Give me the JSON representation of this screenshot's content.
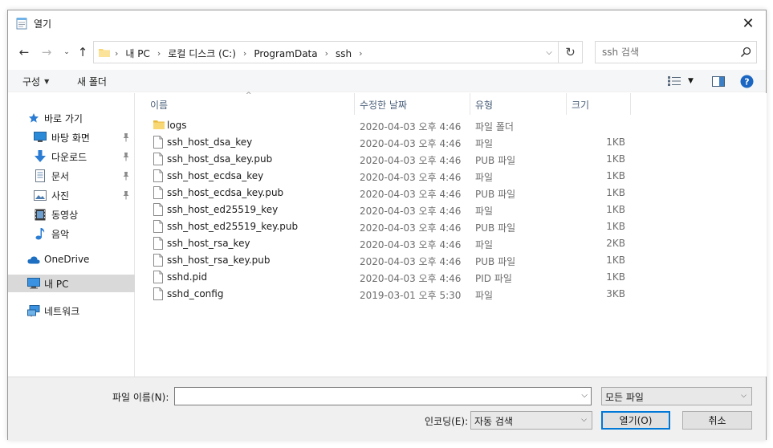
{
  "window": {
    "title": "열기"
  },
  "address": {
    "crumbs": [
      "내 PC",
      "로컬 디스크 (C:)",
      "ProgramData",
      "ssh"
    ]
  },
  "search": {
    "placeholder": "ssh 검색"
  },
  "toolbar": {
    "organize_label": "구성",
    "new_folder_label": "새 폴더"
  },
  "sidebar": {
    "items": [
      {
        "label": "바로 가기",
        "icon": "star-icon"
      },
      {
        "label": "바탕 화면",
        "icon": "desktop-icon",
        "pinned": true
      },
      {
        "label": "다운로드",
        "icon": "download-icon",
        "pinned": true
      },
      {
        "label": "문서",
        "icon": "document-icon",
        "pinned": true
      },
      {
        "label": "사진",
        "icon": "picture-icon",
        "pinned": true
      },
      {
        "label": "동영상",
        "icon": "video-icon"
      },
      {
        "label": "음악",
        "icon": "music-icon"
      },
      {
        "label": "OneDrive",
        "icon": "cloud-icon"
      },
      {
        "label": "내 PC",
        "icon": "computer-icon",
        "selected": true
      },
      {
        "label": "네트워크",
        "icon": "network-icon"
      }
    ]
  },
  "columns": {
    "name": "이름",
    "date": "수정한 날짜",
    "type": "유형",
    "size": "크기"
  },
  "files": [
    {
      "name": "logs",
      "date": "2020-04-03 오후 4:46",
      "type": "파일 폴더",
      "size": "",
      "kind": "folder"
    },
    {
      "name": "ssh_host_dsa_key",
      "date": "2020-04-03 오후 4:46",
      "type": "파일",
      "size": "1KB",
      "kind": "file"
    },
    {
      "name": "ssh_host_dsa_key.pub",
      "date": "2020-04-03 오후 4:46",
      "type": "PUB 파일",
      "size": "1KB",
      "kind": "file"
    },
    {
      "name": "ssh_host_ecdsa_key",
      "date": "2020-04-03 오후 4:46",
      "type": "파일",
      "size": "1KB",
      "kind": "file"
    },
    {
      "name": "ssh_host_ecdsa_key.pub",
      "date": "2020-04-03 오후 4:46",
      "type": "PUB 파일",
      "size": "1KB",
      "kind": "file"
    },
    {
      "name": "ssh_host_ed25519_key",
      "date": "2020-04-03 오후 4:46",
      "type": "파일",
      "size": "1KB",
      "kind": "file"
    },
    {
      "name": "ssh_host_ed25519_key.pub",
      "date": "2020-04-03 오후 4:46",
      "type": "PUB 파일",
      "size": "1KB",
      "kind": "file"
    },
    {
      "name": "ssh_host_rsa_key",
      "date": "2020-04-03 오후 4:46",
      "type": "파일",
      "size": "2KB",
      "kind": "file"
    },
    {
      "name": "ssh_host_rsa_key.pub",
      "date": "2020-04-03 오후 4:46",
      "type": "PUB 파일",
      "size": "1KB",
      "kind": "file"
    },
    {
      "name": "sshd.pid",
      "date": "2020-04-03 오후 4:46",
      "type": "PID 파일",
      "size": "1KB",
      "kind": "file"
    },
    {
      "name": "sshd_config",
      "date": "2019-03-01 오후 5:30",
      "type": "파일",
      "size": "3KB",
      "kind": "file"
    }
  ],
  "bottom": {
    "filename_label": "파일 이름(N):",
    "filename_value": "",
    "filter_value": "모든 파일",
    "encoding_label": "인코딩(E):",
    "encoding_value": "자동 검색",
    "open_label": "열기(O)",
    "cancel_label": "취소"
  },
  "colors": {
    "accent": "#0078d7",
    "header_text": "#4c607a",
    "folder": "#f8d775"
  }
}
